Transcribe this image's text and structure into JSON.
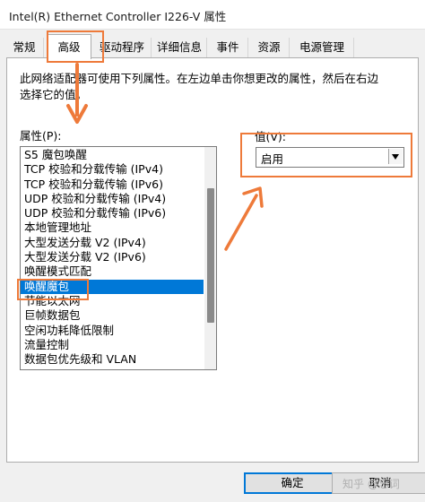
{
  "window": {
    "title": "Intel(R) Ethernet Controller I226-V 属性"
  },
  "tabs": [
    {
      "label": "常规",
      "active": false
    },
    {
      "label": "高级",
      "active": true
    },
    {
      "label": "驱动程序",
      "active": false
    },
    {
      "label": "详细信息",
      "active": false
    },
    {
      "label": "事件",
      "active": false
    },
    {
      "label": "资源",
      "active": false
    },
    {
      "label": "电源管理",
      "active": false
    }
  ],
  "advanced": {
    "description": "此网络适配器可使用下列属性。在左边单击你想更改的属性，然后在右边选择它的值。",
    "property_label": "属性(P):",
    "value_label": "值(V):",
    "properties": [
      "S5 魔包唤醒",
      "TCP 校验和分载传输 (IPv4)",
      "TCP 校验和分载传输 (IPv6)",
      "UDP 校验和分载传输 (IPv4)",
      "UDP 校验和分载传输 (IPv6)",
      "本地管理地址",
      "大型发送分载 V2 (IPv4)",
      "大型发送分载 V2 (IPv6)",
      "唤醒模式匹配",
      "唤醒魔包",
      "节能以太网",
      "巨帧数据包",
      "空闲功耗降低限制",
      "流量控制",
      "数据包优先级和 VLAN"
    ],
    "selected_property": "唤醒魔包",
    "selected_value": "启用"
  },
  "buttons": {
    "ok": "确定",
    "cancel": "取消"
  },
  "watermark": "知乎 @忘词",
  "colors": {
    "selection": "#0078d7",
    "annotation": "#ee7a3a"
  }
}
